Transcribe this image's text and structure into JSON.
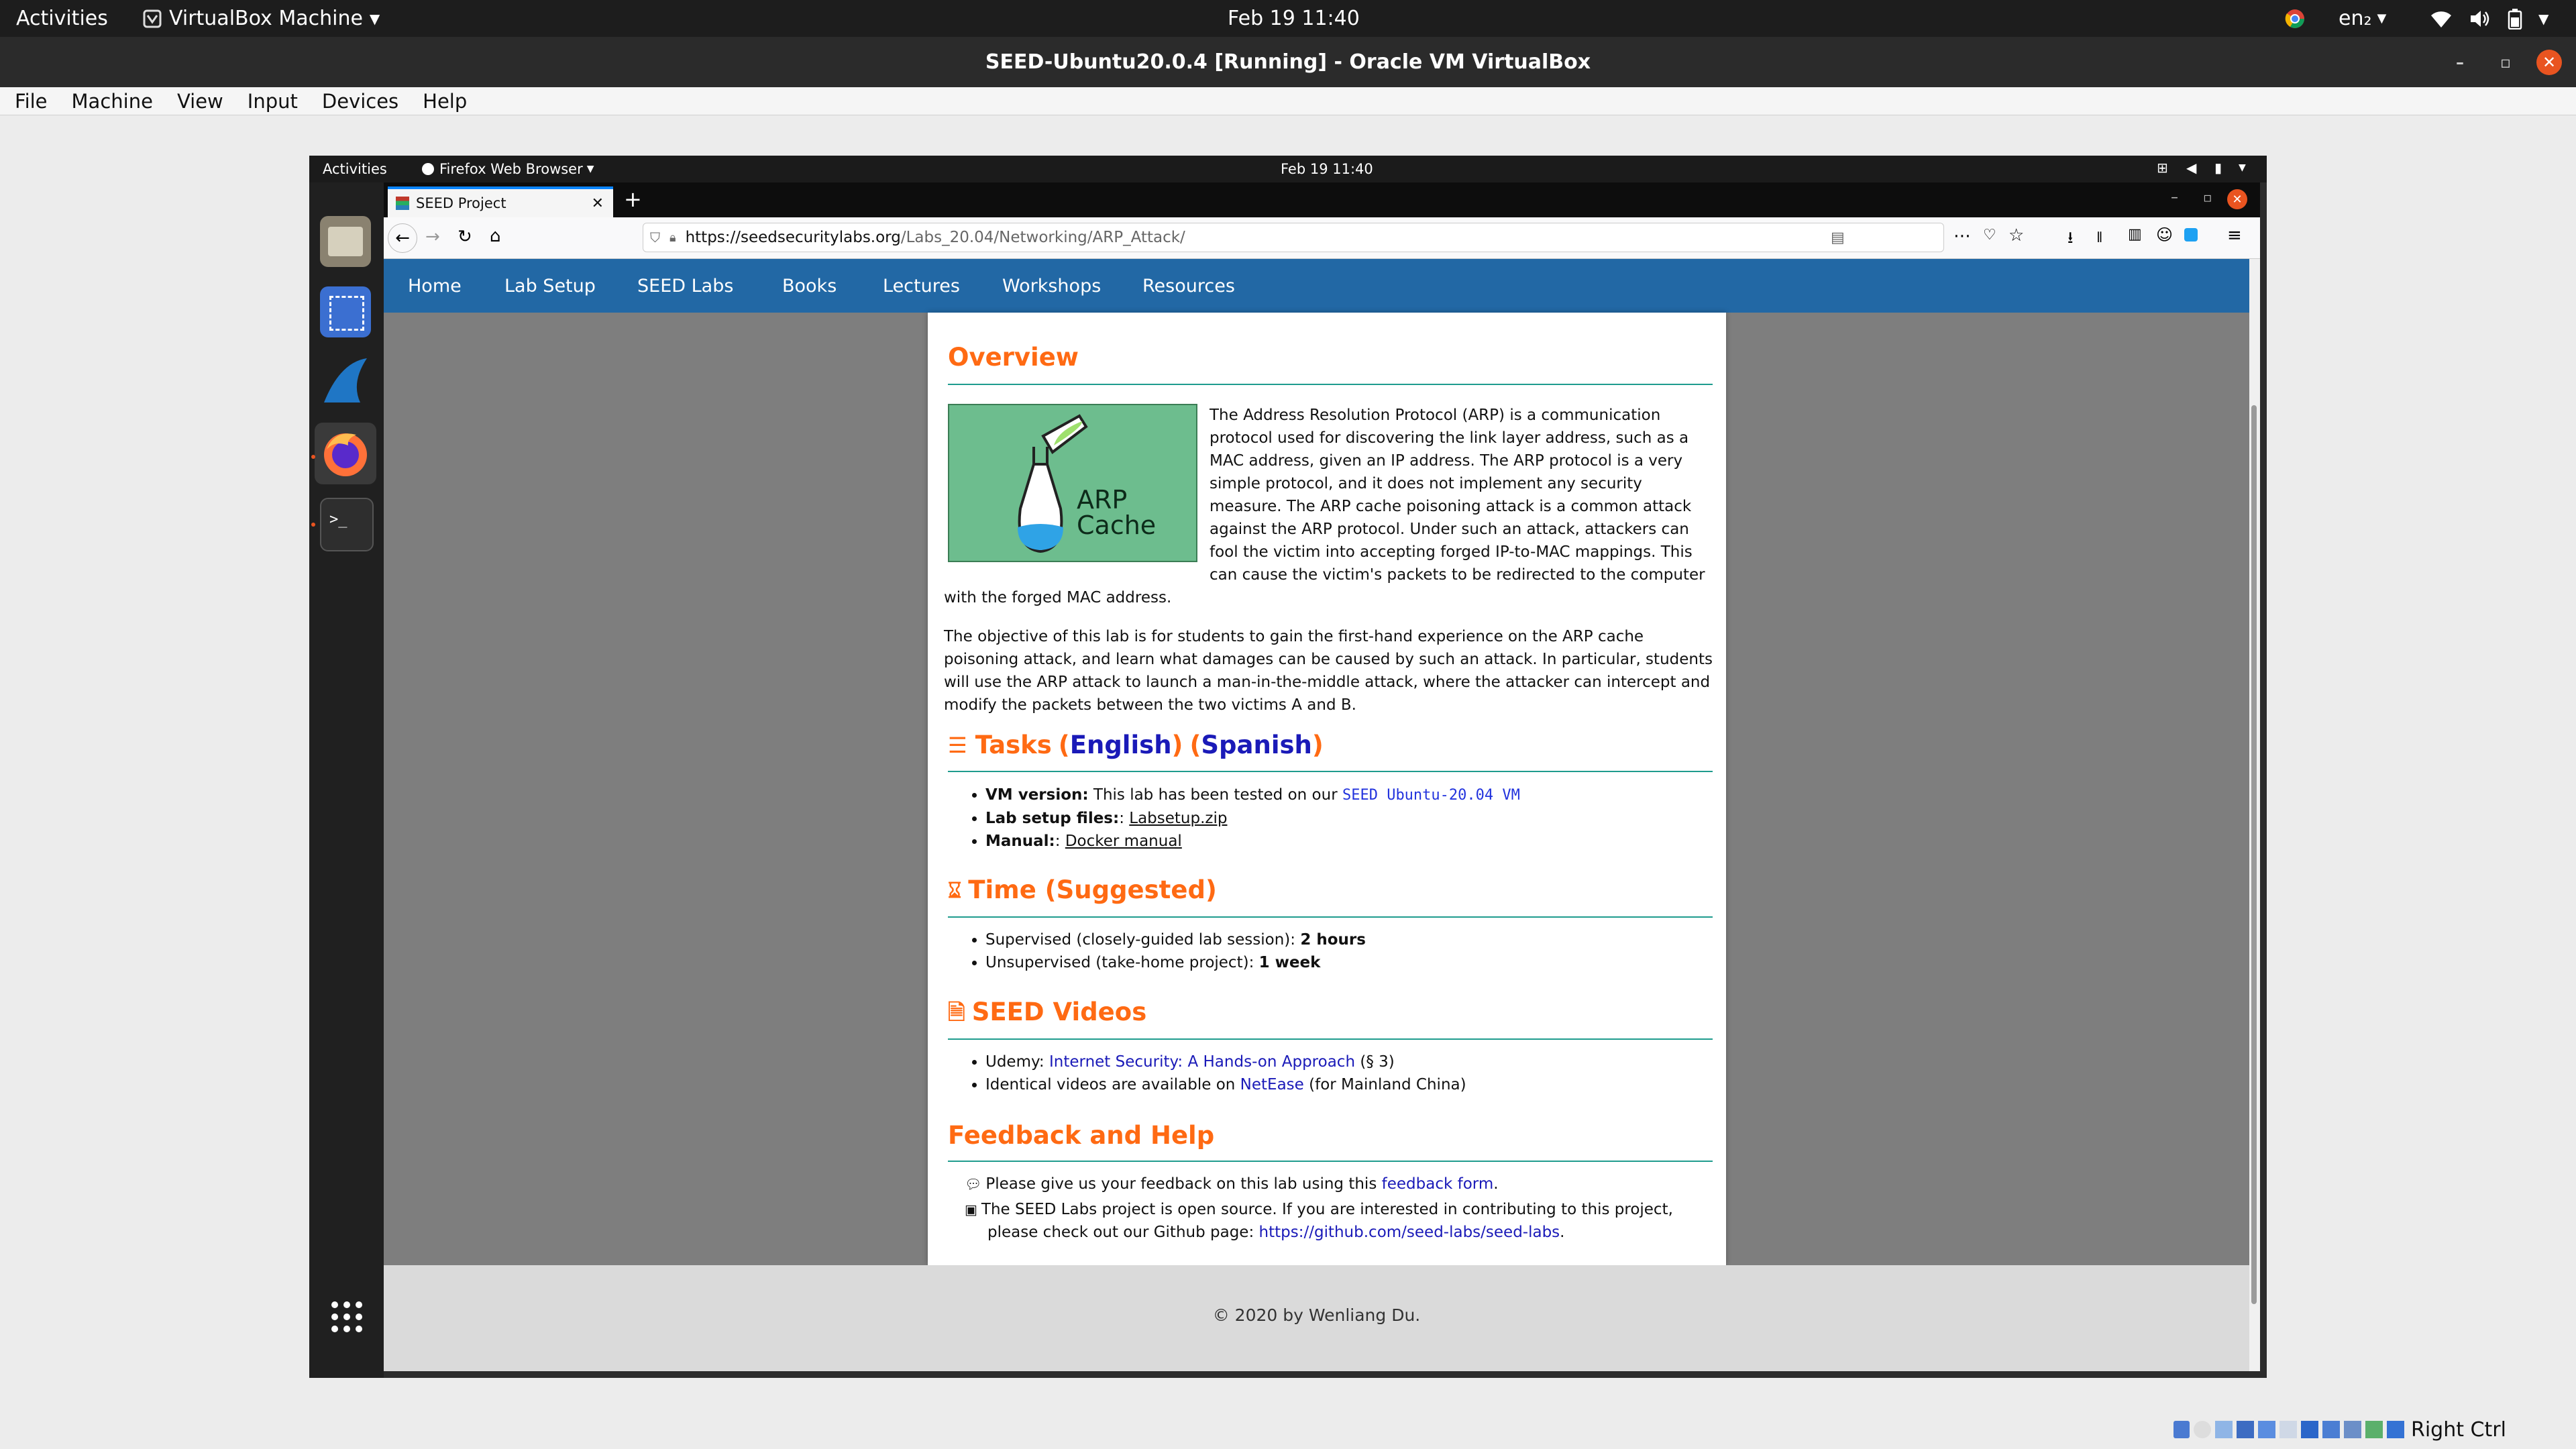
{
  "host": {
    "activities": "Activities",
    "app_menu": "VirtualBox Machine",
    "clock": "Feb 19  11:40",
    "lang": "en₂",
    "window_title": "SEED-Ubuntu20.0.4 [Running] - Oracle VM VirtualBox",
    "menu": [
      "File",
      "Machine",
      "View",
      "Input",
      "Devices",
      "Help"
    ],
    "right_ctrl": "Right Ctrl"
  },
  "guest": {
    "activities": "Activities",
    "app_menu": "Firefox Web Browser",
    "clock": "Feb 19  11:40",
    "dock": [
      "files-icon",
      "screenshot-icon",
      "wireshark-icon",
      "firefox-icon",
      "terminal-icon"
    ]
  },
  "browser": {
    "tab_title": "SEED Project",
    "url_host": "https://seedsecuritylabs.org",
    "url_path": "/Labs_20.04/Networking/ARP_Attack/"
  },
  "site": {
    "nav": [
      "Home",
      "Lab Setup",
      "SEED Labs",
      "Books",
      "Lectures",
      "Workshops",
      "Resources"
    ],
    "overview": {
      "heading": "Overview",
      "image_line1": "ARP",
      "image_line2": "Cache",
      "lines1": [
        "The Address Resolution Protocol (ARP) is a communication",
        "protocol used for discovering the link layer address, such as a",
        "MAC address, given an IP address. The ARP protocol is a very",
        "simple protocol, and it does not implement any security",
        "measure. The ARP cache poisoning attack is a common attack",
        "against the ARP protocol. Under such an attack, attackers can",
        "fool the victim into accepting forged IP-to-MAC mappings. This",
        "can cause the victim's packets to be redirected to the computer"
      ],
      "line_full": "with the forged MAC address.",
      "para2": [
        "The objective of this lab is for students to gain the first-hand experience on the ARP cache",
        "poisoning attack, and learn what damages can be caused by such an attack. In particular, students",
        "will use the ARP attack to launch a man-in-the-middle attack, where the attacker can intercept and",
        "modify the packets between the two victims A and B."
      ]
    },
    "tasks": {
      "heading": "Tasks",
      "english": "English",
      "spanish": "Spanish",
      "vm_label": "VM version:",
      "vm_text": "This lab has been tested on our",
      "vm_link": "SEED Ubuntu-20.04 VM",
      "setup_label": "Lab setup files:",
      "setup_link": "Labsetup.zip",
      "manual_label": "Manual:",
      "manual_link": "Docker manual"
    },
    "time": {
      "heading": "Time (Suggested)",
      "supervised": "Supervised (closely-guided lab session):",
      "supervised_val": "2 hours",
      "unsupervised": "Unsupervised (take-home project):",
      "unsupervised_val": "1 week"
    },
    "videos": {
      "heading": "SEED Videos",
      "udemy": "Udemy:",
      "udemy_link": "Internet Security: A Hands-on Approach",
      "udemy_suffix": "(§ 3)",
      "identical": "Identical videos are available on",
      "netease": "NetEase",
      "china": "(for Mainland China)"
    },
    "feedback": {
      "heading": "Feedback and Help",
      "fb1": "Please give us your feedback on this lab using this",
      "fb1_link": "feedback form",
      "fb2": "The SEED Labs project is open source. If you are interested in contributing to this project,",
      "fb3": "please check out our Github page:",
      "fb3_link": "https://github.com/seed-labs/seed-labs"
    },
    "footer": "© 2020 by Wenliang Du."
  }
}
